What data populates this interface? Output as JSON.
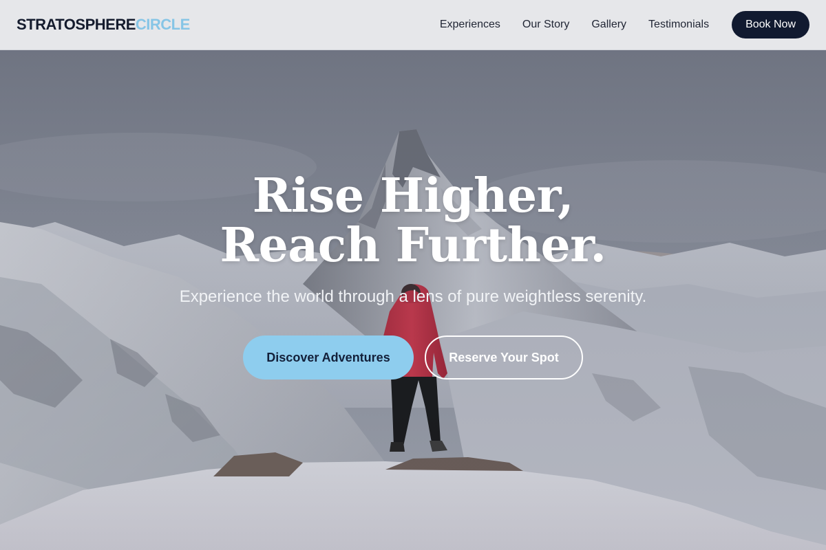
{
  "header": {
    "logo_part1": "STRATOSPHERE",
    "logo_part2": "CIRCLE",
    "nav": [
      {
        "label": "Experiences"
      },
      {
        "label": "Our Story"
      },
      {
        "label": "Gallery"
      },
      {
        "label": "Testimonials"
      }
    ],
    "cta_label": "Book Now"
  },
  "hero": {
    "title": "Rise Higher, Reach Further.",
    "subtitle": "Experience the world through a lens of pure weightless serenity.",
    "primary_button": "Discover Adventures",
    "secondary_button": "Reserve Your Spot"
  },
  "colors": {
    "brand_dark": "#111a30",
    "brand_accent": "#86c5e6",
    "primary_button": "#8ecdee"
  }
}
